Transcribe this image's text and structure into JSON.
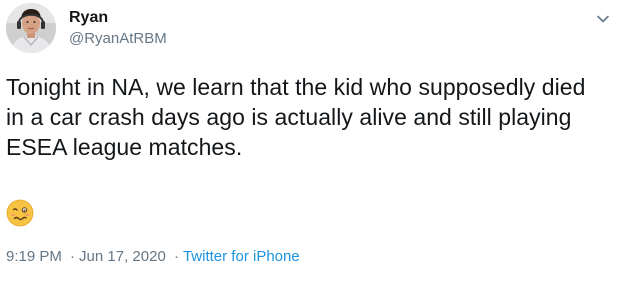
{
  "author": {
    "name": "Ryan",
    "handle": "@RyanAtRBM"
  },
  "tweet": {
    "text": "Tonight in NA, we learn that the kid who supposedly died in a car crash days ago is actually alive and still playing ESEA league matches.",
    "emoji": "woozy-face",
    "time": "9:19 PM",
    "date": "Jun 17, 2020",
    "separator": "·",
    "source": "Twitter for iPhone"
  },
  "icons": {
    "menu": "chevron-down-icon",
    "avatar": "profile-photo"
  },
  "colors": {
    "text": "#14171a",
    "secondary": "#657786",
    "link": "#1b95e0",
    "emoji_face": "#f7c343"
  }
}
